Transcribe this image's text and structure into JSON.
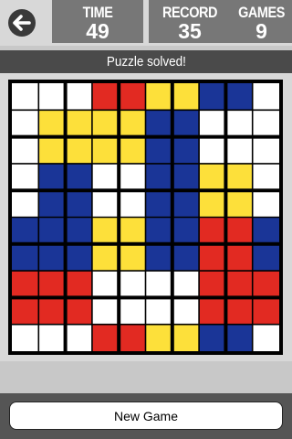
{
  "header": {
    "back_icon": "arrow-left-icon",
    "time": {
      "label": "TIME",
      "value": "49"
    },
    "record": {
      "label": "RECORD",
      "value": "35"
    },
    "games": {
      "label": "GAMES",
      "value": "9"
    }
  },
  "status": {
    "message": "Puzzle solved!"
  },
  "colors": {
    "W": "#ffffff",
    "R": "#e22a22",
    "Y": "#fde03a",
    "B": "#1a3597"
  },
  "board": {
    "rows": [
      [
        "W",
        "W",
        "W",
        "R",
        "R",
        "Y",
        "Y",
        "B",
        "B",
        "W"
      ],
      [
        "W",
        "Y",
        "Y",
        "Y",
        "Y",
        "B",
        "B",
        "W",
        "W",
        "W"
      ],
      [
        "W",
        "Y",
        "Y",
        "Y",
        "Y",
        "B",
        "B",
        "W",
        "W",
        "W"
      ],
      [
        "W",
        "B",
        "B",
        "W",
        "W",
        "B",
        "B",
        "Y",
        "Y",
        "W"
      ],
      [
        "W",
        "B",
        "B",
        "W",
        "W",
        "B",
        "B",
        "Y",
        "Y",
        "W"
      ],
      [
        "B",
        "B",
        "B",
        "Y",
        "Y",
        "B",
        "B",
        "R",
        "R",
        "B"
      ],
      [
        "B",
        "B",
        "B",
        "Y",
        "Y",
        "B",
        "B",
        "R",
        "R",
        "B"
      ],
      [
        "R",
        "R",
        "R",
        "W",
        "W",
        "W",
        "W",
        "R",
        "R",
        "R"
      ],
      [
        "R",
        "R",
        "R",
        "W",
        "W",
        "W",
        "W",
        "R",
        "R",
        "R"
      ],
      [
        "W",
        "W",
        "W",
        "R",
        "R",
        "Y",
        "Y",
        "B",
        "B",
        "W"
      ]
    ]
  },
  "footer": {
    "new_game_label": "New Game"
  }
}
